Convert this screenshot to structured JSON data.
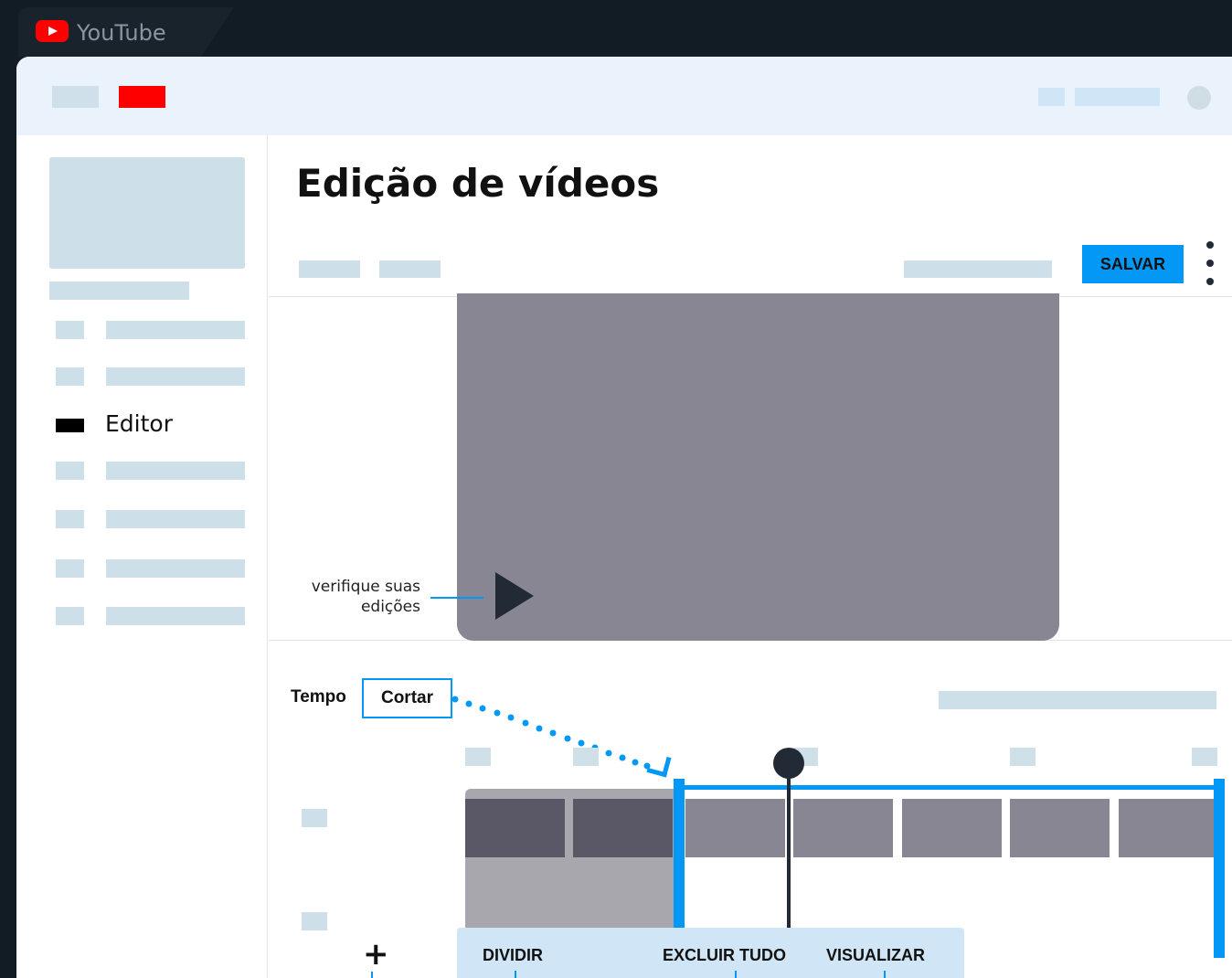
{
  "browser": {
    "tab_title": "YouTube",
    "tab_icon": "youtube-logo-icon"
  },
  "topbar": {
    "logo_color": "#ff0000"
  },
  "sidebar": {
    "active_item": "Editor",
    "items": [
      "",
      "",
      "Editor",
      "",
      "",
      "",
      ""
    ]
  },
  "main": {
    "title": "Edição de vídeos",
    "save_label": "SALVAR",
    "more_icon": "kebab-menu-icon"
  },
  "preview": {
    "annotation": "verifique suas edições",
    "play_icon": "play-icon",
    "annotation_line1": "verifique suas",
    "annotation_line2": "edições"
  },
  "timeline": {
    "tempo_label": "Tempo",
    "cut_label": "Cortar",
    "add_icon": "plus-icon"
  },
  "toolbar": {
    "split_label": "DIVIDIR",
    "delete_all_label": "EXCLUIR TUDO",
    "preview_label": "VISUALIZAR"
  },
  "colors": {
    "accent": "#0397f6",
    "brand": "#ff0000",
    "dark": "#222a35",
    "skeleton": "#cddfe8"
  }
}
